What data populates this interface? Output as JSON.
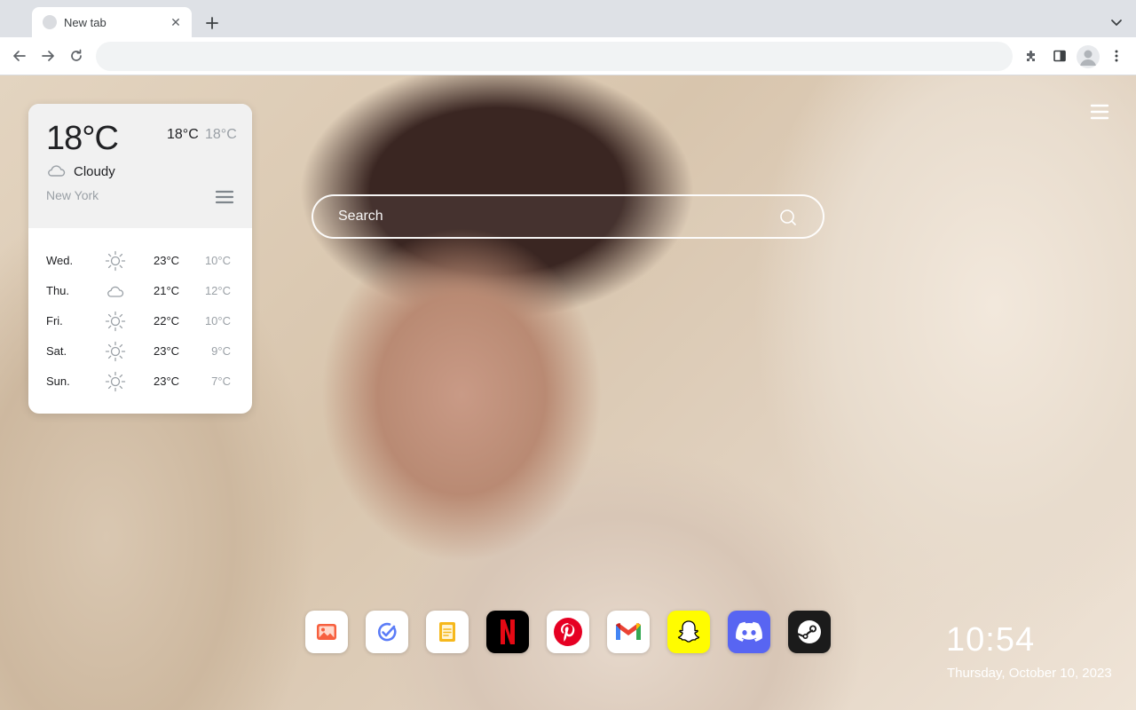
{
  "tab": {
    "title": "New tab",
    "close_symbol": "✕"
  },
  "omnibox": {
    "value": ""
  },
  "weather": {
    "current_temp": "18°C",
    "high": "18°C",
    "low": "18°C",
    "condition": "Cloudy",
    "condition_icon": "cloud-icon",
    "city": "New York",
    "forecast": [
      {
        "day": "Wed.",
        "icon": "sun-icon",
        "high": "23°C",
        "low": "10°C"
      },
      {
        "day": "Thu.",
        "icon": "cloud-icon",
        "high": "21°C",
        "low": "12°C"
      },
      {
        "day": "Fri.",
        "icon": "sun-icon",
        "high": "22°C",
        "low": "10°C"
      },
      {
        "day": "Sat.",
        "icon": "sun-icon",
        "high": "23°C",
        "low": "9°C"
      },
      {
        "day": "Sun.",
        "icon": "sun-icon",
        "high": "23°C",
        "low": "7°C"
      }
    ]
  },
  "search": {
    "placeholder": "Search"
  },
  "dock": {
    "apps": [
      {
        "name": "photos-app",
        "icon": "image-icon",
        "bg": "#ffffff"
      },
      {
        "name": "tasks-app",
        "icon": "check-circle-icon",
        "bg": "#ffffff"
      },
      {
        "name": "notes-app",
        "icon": "note-icon",
        "bg": "#ffffff"
      },
      {
        "name": "netflix-app",
        "icon": "netflix-logo-icon",
        "bg": "#000000"
      },
      {
        "name": "pinterest-app",
        "icon": "pinterest-logo-icon",
        "bg": "#ffffff"
      },
      {
        "name": "gmail-app",
        "icon": "gmail-logo-icon",
        "bg": "#ffffff"
      },
      {
        "name": "snapchat-app",
        "icon": "snapchat-ghost-icon",
        "bg": "#fffc00"
      },
      {
        "name": "discord-app",
        "icon": "discord-logo-icon",
        "bg": "#5865f2"
      },
      {
        "name": "steam-app",
        "icon": "steam-logo-icon",
        "bg": "#1b1b1b"
      }
    ]
  },
  "clock": {
    "time": "10:54",
    "date": "Thursday, October 10, 2023"
  },
  "colors": {
    "text_primary": "#202124",
    "text_muted": "#9aa0a6",
    "chrome_bg": "#dee1e6"
  }
}
